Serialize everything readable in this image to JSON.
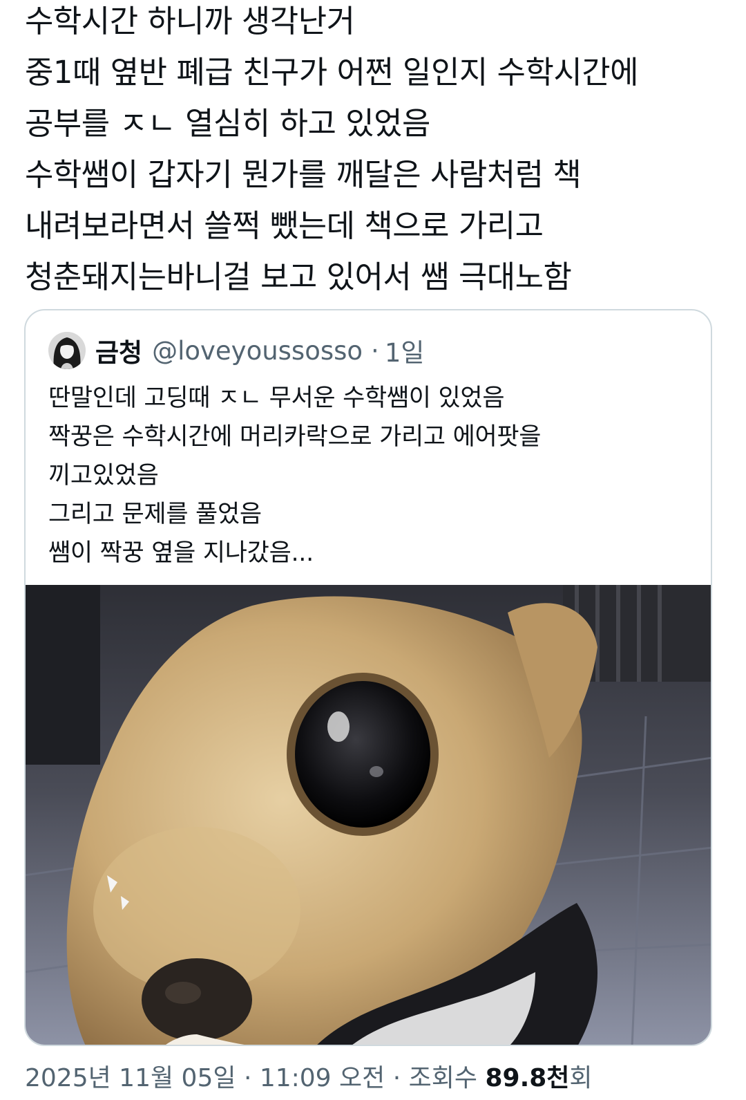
{
  "tweet": {
    "lines": [
      "수학시간 하니까 생각난거",
      "중1때 옆반 폐급 친구가 어쩐 일인지 수학시간에",
      "공부를 ㅈㄴ 열심히 하고 있었음",
      "수학쌤이 갑자기 뭔가를 깨달은 사람처럼 책",
      "내려보라면서 쓸쩍 뺐는데 책으로 가리고",
      "청춘돼지는바니걸 보고 있어서 쌤 극대노함"
    ]
  },
  "quoted_tweet": {
    "display_name": "금청",
    "handle": "@loveyoussosso",
    "separator": "·",
    "time_ago": "1일",
    "lines": [
      "딴말인데 고딩때 ㅈㄴ 무서운 수학쌤이 있었음",
      "짝꿍은 수학시간에 머리카락으로 가리고 에어팟을",
      "끼고있었음",
      "그리고 문제를 풀었음",
      "쌤이 짝꿍 옆을 지나갔음..."
    ],
    "media_description_icon": "chihuahua-photo"
  },
  "meta": {
    "date": "2025년 11월 05일",
    "separator1": "·",
    "time": "11:09 오전",
    "separator2": "·",
    "views_label": "조회수",
    "views_count": "89.8천",
    "views_suffix": "회"
  },
  "colors": {
    "text_primary": "#0f1419",
    "text_secondary": "#536471",
    "border": "#cfd9de"
  }
}
